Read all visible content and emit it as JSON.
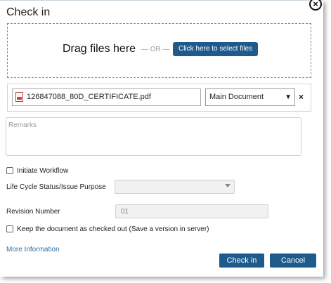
{
  "dialog": {
    "title": "Check in",
    "close_glyph": "×"
  },
  "dropzone": {
    "drag_text": "Drag files here",
    "or_text": "— OR —",
    "select_button": "Click here to select files"
  },
  "file": {
    "name": "126847088_80D_CERTIFICATE.pdf",
    "icon": "pdf-icon",
    "document_type": "Main Document",
    "remove_glyph": "×"
  },
  "remarks": {
    "placeholder": "Remarks"
  },
  "workflow": {
    "initiate_label": "Initiate Workflow",
    "initiate_checked": false
  },
  "lifecycle": {
    "label": "Life Cycle Status/Issue Purpose",
    "value": ""
  },
  "revision": {
    "label": "Revision Number",
    "value": "01"
  },
  "checkout": {
    "label": "Keep the document as checked out (Save a version in server)",
    "checked": false
  },
  "footer": {
    "more_info": "More Information",
    "checkin_button": "Check in",
    "cancel_button": "Cancel"
  },
  "colors": {
    "primary": "#1e5b8c",
    "link": "#2f6ea5"
  }
}
